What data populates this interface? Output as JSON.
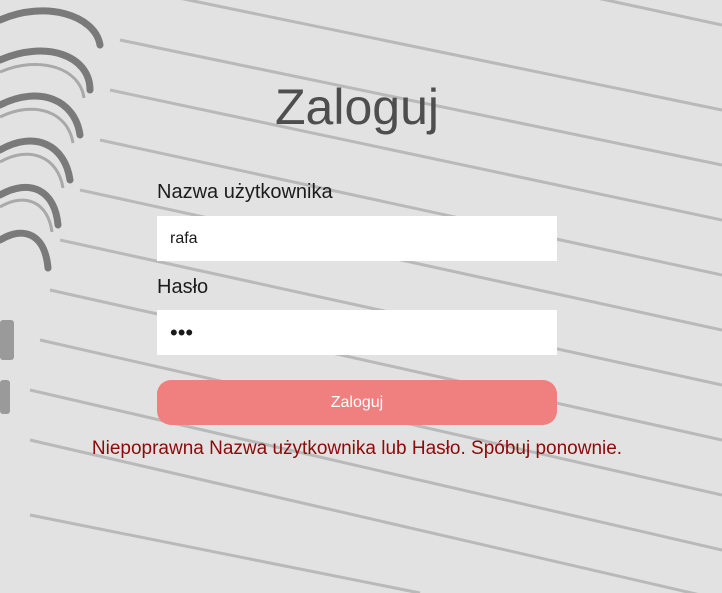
{
  "page": {
    "title": "Zaloguj"
  },
  "form": {
    "username_label": "Nazwa użytkownika",
    "username_value": "rafa",
    "password_label": "Hasło",
    "password_masked": "•••",
    "submit_label": "Zaloguj"
  },
  "error": {
    "message": "Niepoprawna Nazwa użytkownika lub Hasło. Spóbuj ponownie."
  },
  "colors": {
    "background": "#e2e2e2",
    "button": "#f08080",
    "error_text": "#8b0a0a",
    "title_text": "#4e4e4e"
  }
}
